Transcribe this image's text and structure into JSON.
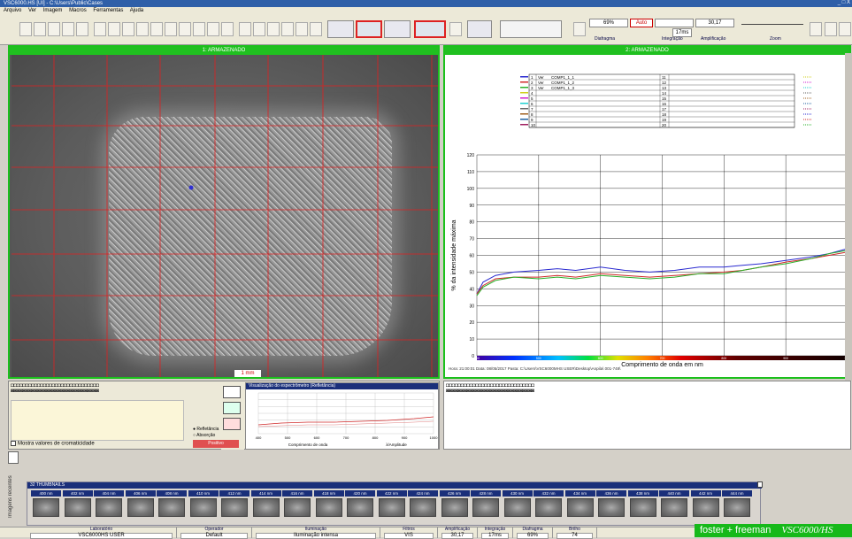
{
  "titlebar": {
    "title": "VSC6000.HS [UI] - C:\\Users\\Public\\Cases",
    "controls": "_ □ X"
  },
  "menu": [
    "Arquivo",
    "Ver",
    "Imagem",
    "Macros",
    "Ferramentas",
    "Ajuda"
  ],
  "toolbar": {
    "diafragma_value": "69%",
    "diafragma_label": "Diafragma",
    "auto_label": "Auto",
    "integracao_value": "17ms",
    "integracao_label": "Integração",
    "amplificacao_value": "30,17",
    "amplificacao_label": "Amplificação",
    "zoom_label": "Zoom"
  },
  "left_panel": {
    "header": "1: ARMAZENADO",
    "scale": "1 mm"
  },
  "right_panel": {
    "header": "2: ARMAZENADO",
    "footer": "Hora: 21:00:01   Data: 08/05/2017   Pasta: C:\\Users\\VSC6000MHS USER\\Desktop\\Anpila\\ 001-748\\",
    "legend_rows": [
      {
        "n": "1",
        "k": "Ver",
        "f": "COMP1_1_1",
        "n2": "11"
      },
      {
        "n": "2",
        "k": "Ver",
        "f": "COMP1_1_2",
        "n2": "12"
      },
      {
        "n": "3",
        "k": "Ver",
        "f": "COMP1_1_3",
        "n2": "13"
      },
      {
        "n": "4",
        "k": "",
        "f": "",
        "n2": "14"
      },
      {
        "n": "5",
        "k": "",
        "f": "",
        "n2": "15"
      },
      {
        "n": "6",
        "k": "",
        "f": "",
        "n2": "16"
      },
      {
        "n": "7",
        "k": "",
        "f": "",
        "n2": "17"
      },
      {
        "n": "8",
        "k": "",
        "f": "",
        "n2": "18"
      },
      {
        "n": "9",
        "k": "",
        "f": "",
        "n2": "19"
      },
      {
        "n": "10",
        "k": "",
        "f": "",
        "n2": "20"
      }
    ]
  },
  "chart_data": {
    "type": "line",
    "xlabel": "Comprimento de onda em nm",
    "ylabel": "% da intensidade máxima",
    "xlim": [
      400,
      1000
    ],
    "ylim": [
      0,
      120
    ],
    "xticks": [
      400,
      500,
      600,
      700,
      800,
      900,
      1000
    ],
    "yticks": [
      0,
      10,
      20,
      30,
      40,
      50,
      60,
      70,
      80,
      90,
      100,
      110,
      120
    ],
    "grid": true,
    "series": [
      {
        "color": "#2a2ad0",
        "x": [
          400,
          410,
          430,
          460,
          500,
          530,
          560,
          600,
          640,
          680,
          720,
          760,
          800,
          830,
          860,
          900,
          940,
          970,
          1000
        ],
        "y": [
          37,
          44,
          48,
          50,
          51,
          52,
          51,
          53,
          51,
          50,
          51,
          53,
          53,
          54,
          55,
          57,
          59,
          61,
          64
        ]
      },
      {
        "color": "#d02a2a",
        "x": [
          400,
          410,
          430,
          460,
          500,
          530,
          560,
          600,
          640,
          680,
          720,
          760,
          800,
          830,
          860,
          900,
          940,
          970,
          1000
        ],
        "y": [
          37,
          42,
          46,
          47,
          47,
          48,
          47,
          49,
          48,
          47,
          48,
          49,
          50,
          51,
          53,
          56,
          58,
          60,
          62
        ]
      },
      {
        "color": "#2ab02a",
        "x": [
          400,
          410,
          430,
          460,
          500,
          530,
          560,
          600,
          640,
          680,
          720,
          760,
          800,
          830,
          860,
          900,
          940,
          970,
          1000
        ],
        "y": [
          36,
          41,
          45,
          47,
          46,
          47,
          46,
          48,
          47,
          46,
          47,
          49,
          49,
          51,
          53,
          55,
          58,
          61,
          63
        ]
      }
    ]
  },
  "mini_spectrum": {
    "header": "Visualização do espectrômetro (Refletância)",
    "xlabel": "Comprimento de onda",
    "ylabel_right": "λ/Amplitude",
    "xticks": [
      "400",
      "500",
      "600",
      "700",
      "800",
      "900",
      "1000"
    ],
    "radio_ref": "Refletância",
    "radio_abs": "Absorção",
    "btn_pos": "Positivo"
  },
  "mostra_label": "Mostra valores de cromaticidade",
  "recent_label": "Imagens recentes",
  "thumbnails": {
    "header": "32 THUMBNAILS",
    "labels": [
      "400 nm",
      "402 nm",
      "404 nm",
      "406 nm",
      "408 nm",
      "410 nm",
      "412 nm",
      "414 nm",
      "416 nm",
      "418 nm",
      "420 nm",
      "422 nm",
      "424 nm",
      "426 nm",
      "428 nm",
      "430 nm",
      "432 nm",
      "434 nm",
      "436 nm",
      "438 nm",
      "440 nm",
      "442 nm",
      "444 nm"
    ]
  },
  "status": [
    {
      "label": "Laboratório",
      "value": "VSC6000HS USER"
    },
    {
      "label": "Operador",
      "value": "Default"
    },
    {
      "label": "Iluminação",
      "value": "Iluminação intensa"
    },
    {
      "label": "Filtros",
      "value": "VIS"
    },
    {
      "label": "Amplificação",
      "value": "30,17"
    },
    {
      "label": "Integração",
      "value": "17ms"
    },
    {
      "label": "Diafragma",
      "value": "69%"
    },
    {
      "label": "Brilho",
      "value": "74"
    }
  ],
  "brand": {
    "name": "foster + freeman",
    "model": "VSC6000/HS"
  }
}
